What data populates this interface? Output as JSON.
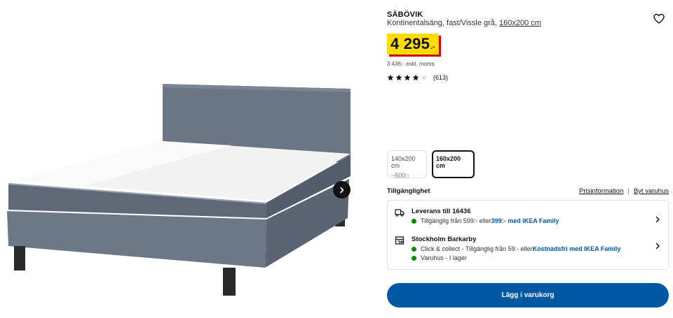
{
  "product": {
    "name": "SÄBÖVIK",
    "description": "Kontinentalsäng, fast/Vissle grå, ",
    "size_link": "160x200 cm",
    "price": "4 295",
    "price_suffix": ".-",
    "vat_note": "3 436:- exkl. moms",
    "rating": {
      "stars": 4,
      "max": 5,
      "count": "(613)"
    }
  },
  "gallery": {
    "next_icon": "chevron-right-icon"
  },
  "sizes": [
    {
      "label": "140x200 cm",
      "sub": "−500:-",
      "selected": false
    },
    {
      "label": "160x200 cm",
      "sub": "",
      "selected": true
    }
  ],
  "availability": {
    "title": "Tillgänglighet",
    "links": {
      "price_info": "Prisinformation",
      "separator": "|",
      "change_store": "Byt varuhus"
    },
    "delivery": {
      "heading": "Leverans till 16436",
      "line_prefix": "Tillgänglig från 599:- eller ",
      "line_highlight": "399:- med IKEA Family"
    },
    "store": {
      "heading": "Stockholm Barkarby",
      "line1_prefix": "Click & collect - Tillgänglig från 59:- eller ",
      "line1_highlight": "Kostnadsfri med IKEA Family",
      "line2": "Varuhus - I lager"
    }
  },
  "cart_button": "Lägg i varukorg",
  "colors": {
    "price_bg": "#ffdb00",
    "price_shadow": "#cc0008",
    "primary": "#0058a3",
    "in_stock": "#0a8a00"
  }
}
